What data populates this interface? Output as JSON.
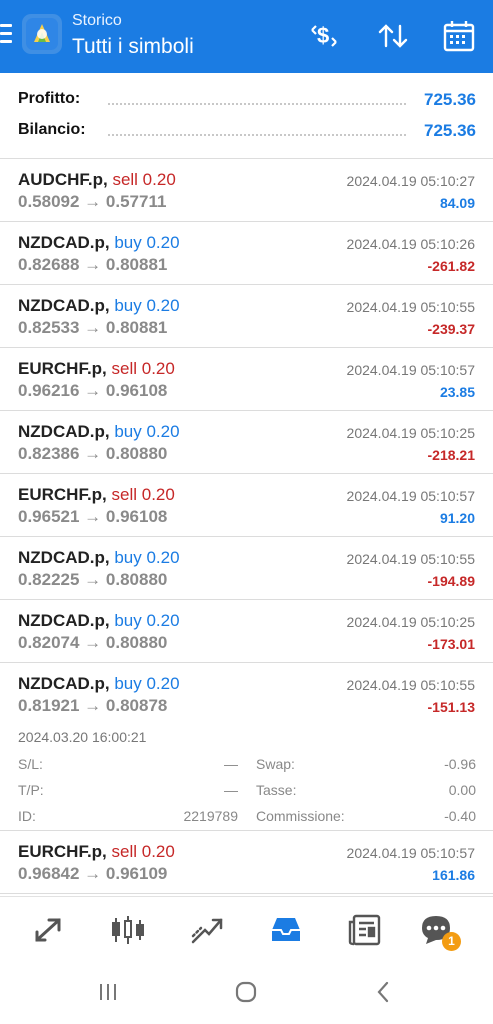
{
  "header": {
    "subtitle": "Storico",
    "title": "Tutti i simboli",
    "accent_color": "#1b7ce3"
  },
  "summary": {
    "profit_label": "Profitto:",
    "profit_value": "725.36",
    "balance_label": "Bilancio:",
    "balance_value": "725.36"
  },
  "trades": [
    {
      "symbol": "AUDCHF.p,",
      "side": "sell 0.20",
      "prices": "0.58092 → 0.57711",
      "time": "2024.04.19 05:10:27",
      "profit": "84.09"
    },
    {
      "symbol": "NZDCAD.p,",
      "side": "buy 0.20",
      "prices": "0.82688 → 0.80881",
      "time": "2024.04.19 05:10:26",
      "profit": "-261.82"
    },
    {
      "symbol": "NZDCAD.p,",
      "side": "buy 0.20",
      "prices": "0.82533 → 0.80881",
      "time": "2024.04.19 05:10:55",
      "profit": "-239.37"
    },
    {
      "symbol": "EURCHF.p,",
      "side": "sell 0.20",
      "prices": "0.96216 → 0.96108",
      "time": "2024.04.19 05:10:57",
      "profit": "23.85"
    },
    {
      "symbol": "NZDCAD.p,",
      "side": "buy 0.20",
      "prices": "0.82386 → 0.80880",
      "time": "2024.04.19 05:10:25",
      "profit": "-218.21"
    },
    {
      "symbol": "EURCHF.p,",
      "side": "sell 0.20",
      "prices": "0.96521 → 0.96108",
      "time": "2024.04.19 05:10:57",
      "profit": "91.20"
    },
    {
      "symbol": "NZDCAD.p,",
      "side": "buy 0.20",
      "prices": "0.82225 → 0.80880",
      "time": "2024.04.19 05:10:55",
      "profit": "-194.89"
    },
    {
      "symbol": "NZDCAD.p,",
      "side": "buy 0.20",
      "prices": "0.82074 → 0.80880",
      "time": "2024.04.19 05:10:25",
      "profit": "-173.01"
    },
    {
      "symbol": "NZDCAD.p,",
      "side": "buy 0.20",
      "prices": "0.81921 → 0.80878",
      "time": "2024.04.19 05:10:55",
      "profit": "-151.13"
    },
    {
      "symbol": "EURCHF.p,",
      "side": "sell 0.20",
      "prices": "0.96842 → 0.96109",
      "time": "2024.04.19 05:10:57",
      "profit": "161.86"
    }
  ],
  "expanded": {
    "open_time": "2024.03.20 16:00:21",
    "sl_label": "S/L:",
    "sl_value": "—",
    "tp_label": "T/P:",
    "tp_value": "—",
    "id_label": "ID:",
    "id_value": "2219789",
    "swap_label": "Swap:",
    "swap_value": "-0.96",
    "tax_label": "Tasse:",
    "tax_value": "0.00",
    "commission_label": "Commissione:",
    "commission_value": "-0.40"
  },
  "bottom_nav": {
    "items": [
      {
        "icon": "quotes-icon"
      },
      {
        "icon": "chart-icon"
      },
      {
        "icon": "trade-icon"
      },
      {
        "icon": "history-icon"
      },
      {
        "icon": "news-icon"
      },
      {
        "icon": "chat-icon",
        "badge": "1"
      }
    ]
  },
  "colors": {
    "sell": "#c62828",
    "buy": "#1b7ce3",
    "positive": "#1b7ce3",
    "negative": "#c62828"
  }
}
